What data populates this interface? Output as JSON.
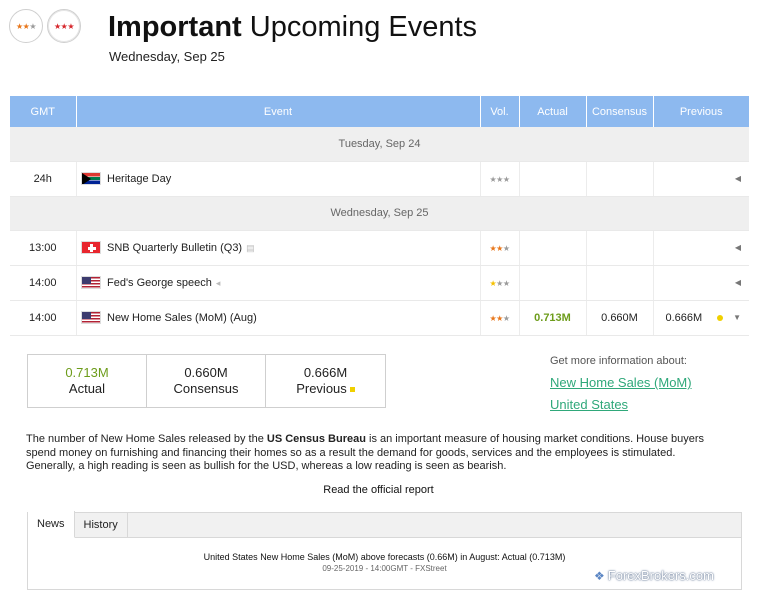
{
  "header": {
    "filters": [
      {
        "on": 2,
        "off": 1
      },
      {
        "on": 3,
        "off": 0
      }
    ],
    "title_bold": "Important",
    "title_rest": " Upcoming Events",
    "date": "Wednesday, Sep 25"
  },
  "table": {
    "columns": {
      "gmt": "GMT",
      "event": "Event",
      "vol": "Vol.",
      "actual": "Actual",
      "consensus": "Consensus",
      "previous": "Previous"
    },
    "date_1": "Tuesday, Sep 24",
    "date_2": "Wednesday, Sep 25",
    "rows": [
      {
        "time": "24h",
        "flag": "south-africa-flag",
        "event": "Heritage Day",
        "volatility": 0,
        "actual": "",
        "consensus": "",
        "previous": ""
      },
      {
        "time": "13:00",
        "flag": "switzerland-flag",
        "event": "SNB Quarterly Bulletin (Q3)",
        "icon": "report-icon",
        "volatility": 2,
        "actual": "",
        "consensus": "",
        "previous": ""
      },
      {
        "time": "14:00",
        "flag": "usa-flag",
        "event": "Fed's George speech",
        "icon": "speech-icon",
        "volatility": 1,
        "actual": "",
        "consensus": "",
        "previous": ""
      },
      {
        "time": "14:00",
        "flag": "usa-flag",
        "event": "New Home Sales (MoM) (Aug)",
        "volatility": 2,
        "actual": "0.713M",
        "consensus": "0.660M",
        "previous": "0.666M"
      }
    ]
  },
  "detail": {
    "actual_value": "0.713M",
    "actual_label": "Actual",
    "consensus_value": "0.660M",
    "consensus_label": "Consensus",
    "previous_value": "0.666M",
    "previous_label": "Previous",
    "more_info_label": "Get more information about:",
    "link_1": "New Home Sales (MoM)",
    "link_2": "United States",
    "desc_1": "The number of New Home Sales released by the ",
    "desc_bold": "US Census Bureau",
    "desc_2": " is an important measure of housing market conditions. House buyers spend money on furnishing and financing their homes so as a result the demand for goods, services and the employees is stimulated. Generally, a high reading is seen as bullish for the USD, whereas a low reading is seen as bearish.",
    "read_report": "Read the official report"
  },
  "tabs": {
    "news": "News",
    "history": "History",
    "news_headline": "United States New Home Sales (MoM) above forecasts (0.66M) in August: Actual (0.713M)",
    "news_meta": "09-25-2019 - 14:00GMT - FXStreet"
  },
  "watermark": "ForexBrokers.com",
  "colors": {
    "header_blue": "#8db9ef",
    "star_orange": "#e8761a",
    "star_yellow": "#f5c000",
    "actual_green": "#6d9c1b",
    "link_green": "#2fa87a"
  }
}
